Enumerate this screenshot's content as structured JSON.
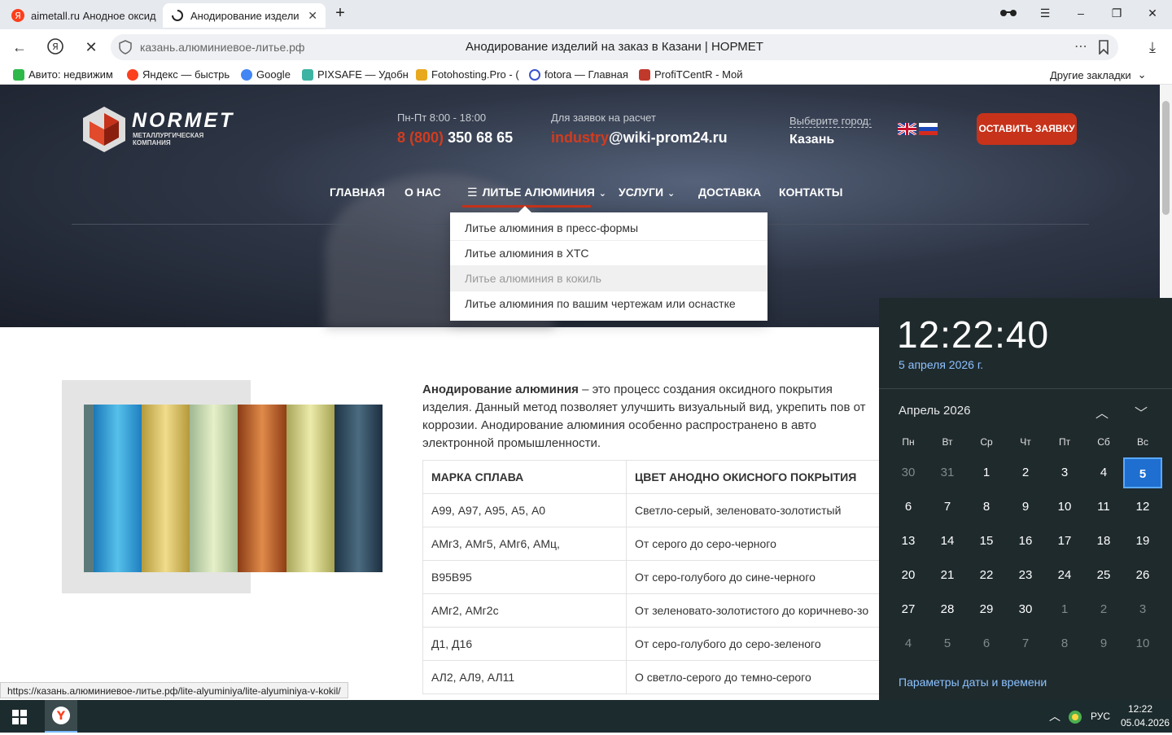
{
  "browser": {
    "tabs": [
      {
        "label": "aimetall.ru Анодное оксид",
        "active": false
      },
      {
        "label": "Анодирование издели",
        "active": true
      }
    ],
    "address": {
      "url": "казань.алюминиевое-литье.рф",
      "page_title": "Анодирование изделий на заказ в Казани | НОРМЕТ"
    },
    "bookmarks": [
      {
        "label": "Авито: недвижим",
        "color": "#2fb84a"
      },
      {
        "label": "Яндекс — быстрь",
        "color": "#fc3f1d"
      },
      {
        "label": "Google",
        "color": "#4285f4"
      },
      {
        "label": "PIXSAFE — Удобн",
        "color": "#3db3a4"
      },
      {
        "label": "Fotohosting.Pro - (",
        "color": "#e8a91e"
      },
      {
        "label": "fotora — Главная",
        "color": "#3a52d0"
      },
      {
        "label": "ProfiTCentR - Мой",
        "color": "#c0392b"
      }
    ],
    "other_bookmarks": "Другие закладки",
    "status_url": "https://казань.алюминиевое-литье.рф/lite-alyuminiya/lite-alyuminiya-v-kokil/"
  },
  "site": {
    "logo": {
      "name": "NORMET",
      "sub1": "металлургическая",
      "sub2": "компания"
    },
    "hours": "Пн-Пт 8:00 - 18:00",
    "phone_code": "8 (800)",
    "phone_number": "350 68 65",
    "requests_label": "Для заявок на расчет",
    "email_user": "industry",
    "email_domain": "@wiki-prom24.ru",
    "city_label": "Выберите город:",
    "city": "Казань",
    "cta": "ОСТАВИТЬ ЗАЯВКУ",
    "menu": [
      "ГЛАВНАЯ",
      "О НАС",
      "ЛИТЬЕ АЛЮМИНИЯ",
      "УСЛУГИ",
      "ДОСТАВКА",
      "КОНТАКТЫ"
    ],
    "dropdown": [
      "Литье алюминия в пресс-формы",
      "Литье алюминия в ХТС",
      "Литье алюминия в кокиль",
      "Литье алюминия по вашим чертежам или оснастке"
    ],
    "intro_bold": "Анодирование алюминия",
    "intro_text": " – это процесс создания оксидного покрытия изделия. Данный метод позволяет улучшить визуальный вид, укрепить пов от коррозии. Анодирование алюминия особенно распространено в авто электронной промышленности.",
    "table": {
      "headers": [
        "МАРКА СПЛАВА",
        "ЦВЕТ АНОДНО ОКИСНОГО ПОКРЫТИЯ"
      ],
      "rows": [
        [
          "А99, А97, А95, А5, А0",
          "Светло-серый, зеленовато-золотистый"
        ],
        [
          "АМг3, АМг5, АМг6, АМц,",
          "От серого до серо-черного"
        ],
        [
          "В95В95",
          "От серо-голубого до сине-черного"
        ],
        [
          "АМг2, АМг2с",
          "От зеленовато-золотистого до коричнево-зо"
        ],
        [
          "Д1, Д16",
          "От серо-голубого до серо-зеленого"
        ],
        [
          "АЛ2, АЛ9, АЛ11",
          "О светло-серого до темно-серого"
        ]
      ]
    }
  },
  "clock": {
    "time": "12:22:40",
    "date": "5 апреля 2026 г.",
    "month": "Апрель 2026",
    "weekdays": [
      "Пн",
      "Вт",
      "Ср",
      "Чт",
      "Пт",
      "Сб",
      "Вс"
    ],
    "weeks": [
      [
        "30",
        "31",
        "1",
        "2",
        "3",
        "4",
        "5"
      ],
      [
        "6",
        "7",
        "8",
        "9",
        "10",
        "11",
        "12"
      ],
      [
        "13",
        "14",
        "15",
        "16",
        "17",
        "18",
        "19"
      ],
      [
        "20",
        "21",
        "22",
        "23",
        "24",
        "25",
        "26"
      ],
      [
        "27",
        "28",
        "29",
        "30",
        "1",
        "2",
        "3"
      ],
      [
        "4",
        "5",
        "6",
        "7",
        "8",
        "9",
        "10"
      ]
    ],
    "settings_link": "Параметры даты и времени"
  },
  "taskbar": {
    "language": "РУС",
    "time": "12:22",
    "date": "05.04.2026"
  }
}
